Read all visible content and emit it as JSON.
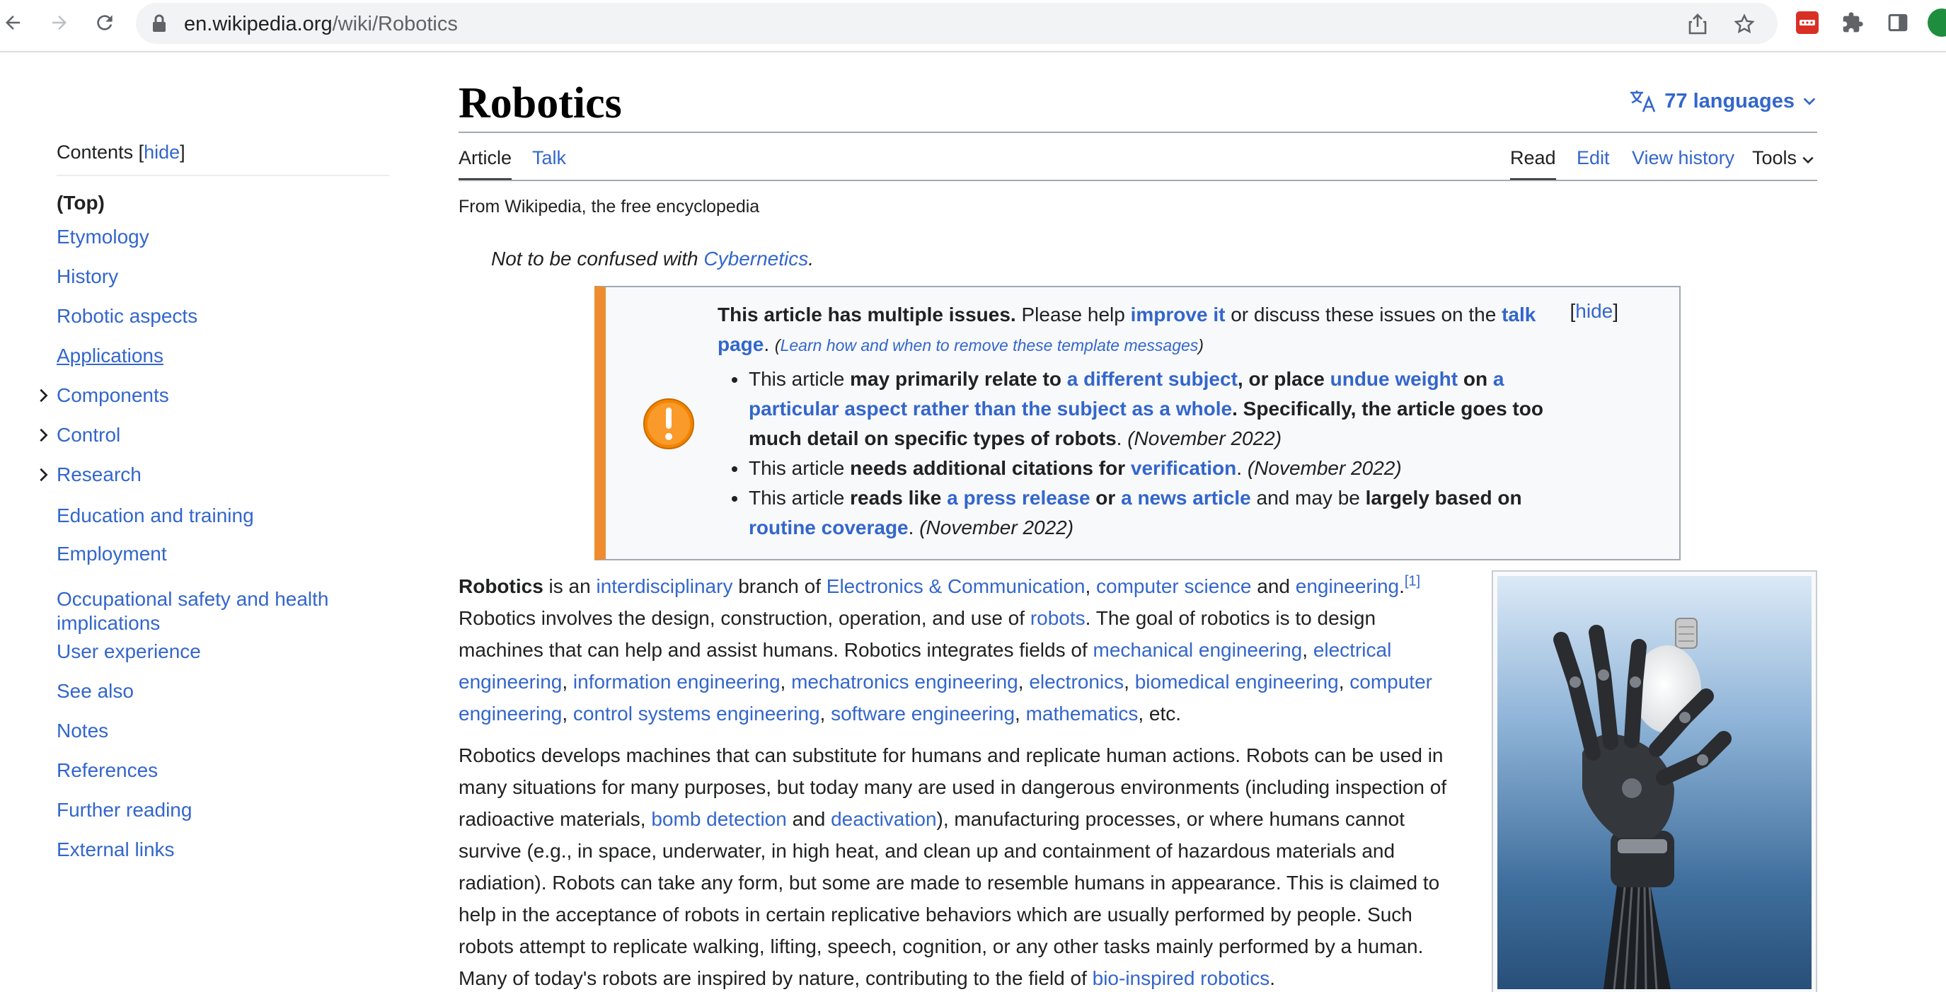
{
  "browser": {
    "url_host": "en.wikipedia.org",
    "url_path": "/wiki/Robotics"
  },
  "toc": {
    "label": "Contents",
    "hide_label": "hide",
    "items": [
      {
        "label": "(Top)"
      },
      {
        "label": "Etymology"
      },
      {
        "label": "History"
      },
      {
        "label": "Robotic aspects"
      },
      {
        "label": "Applications"
      },
      {
        "label": "Components"
      },
      {
        "label": "Control"
      },
      {
        "label": "Research"
      },
      {
        "label": "Education and training"
      },
      {
        "label": "Employment"
      },
      {
        "label": "Occupational safety and health implications"
      },
      {
        "label": "User experience"
      },
      {
        "label": "See also"
      },
      {
        "label": "Notes"
      },
      {
        "label": "References"
      },
      {
        "label": "Further reading"
      },
      {
        "label": "External links"
      }
    ]
  },
  "page": {
    "title": "Robotics",
    "languages_label": "77 languages",
    "tabs": {
      "article": "Article",
      "talk": "Talk",
      "read": "Read",
      "edit": "Edit",
      "history": "View history",
      "tools": "Tools"
    },
    "tagline": "From Wikipedia, the free encyclopedia",
    "hatnote_text": "Not to be confused with ",
    "hatnote_link": "Cybernetics",
    "hatnote_end": "."
  },
  "ambox": {
    "hide_label": "hide",
    "header_bold": "This article has multiple issues.",
    "header_text1": " Please help ",
    "header_link1": "improve it",
    "header_text2": " or discuss these issues on the ",
    "header_link2": "talk page",
    "header_text3": ". ",
    "learn_link": "Learn how and when to remove these template messages",
    "issue1": {
      "t1": "This article ",
      "b1": "may primarily relate to ",
      "l1": "a different subject",
      "b2": ", or place ",
      "l2": "undue weight",
      "b3": " on ",
      "l3": "a particular aspect rather than the subject as a whole",
      "b4": ". Specifically, the article goes too much detail on specific types of robots",
      "t2": ". ",
      "date": "(November 2022)"
    },
    "issue2": {
      "t1": "This article ",
      "b1": "needs additional citations for ",
      "l1": "verification",
      "t2": ". ",
      "date": "(November 2022)"
    },
    "issue3": {
      "t1": "This article ",
      "b1": "reads like ",
      "l1": "a press release",
      "b2": " or ",
      "l2": "a news article",
      "t2": " and may be ",
      "b3": "largely based on ",
      "l3": "routine coverage",
      "t3": ". ",
      "date": "(November 2022)"
    }
  },
  "body": {
    "p1": {
      "bold": "Robotics",
      "t1": " is an ",
      "l1": "interdisciplinary",
      "t2": " branch of ",
      "l2": "Electronics & Communication",
      "t3": ", ",
      "l3": "computer science",
      "t4": " and ",
      "l4": "engineering",
      "t5": ".",
      "ref": "[1]",
      "t6": " Robotics involves the design, construction, operation, and use of ",
      "l5": "robots",
      "t7": ". The goal of robotics is to design machines that can help and assist humans. Robotics integrates fields of ",
      "l6": "mechanical engineering",
      "t8": ", ",
      "l7": "electrical engineering",
      "t9": ", ",
      "l8": "information engineering",
      "t10": ", ",
      "l9": "mechatronics engineering",
      "t11": ", ",
      "l10": "electronics",
      "t12": ", ",
      "l11": "biomedical engineering",
      "t13": ", ",
      "l12": "computer engineering",
      "t14": ", ",
      "l13": "control systems engineering",
      "t15": ", ",
      "l14": "software engineering",
      "t16": ", ",
      "l15": "mathematics",
      "t17": ", etc."
    },
    "p2": {
      "t1": "Robotics develops machines that can substitute for humans and replicate human actions. Robots can be used in many situations for many purposes, but today many are used in dangerous environments (including inspection of radioactive materials, ",
      "l1": "bomb detection",
      "t2": " and ",
      "l2": "deactivation",
      "t3": "), manufacturing processes, or where humans cannot survive (e.g., in space, underwater, in high heat, and clean up and containment of hazardous materials and radiation). Robots can take any form, but some are made to resemble humans in appearance. This is claimed to help in the acceptance of robots in certain replicative behaviors which are usually performed by people. Such robots attempt to replicate walking, lifting, speech, cognition, or any other tasks mainly performed by a human. Many of today's robots are inspired by nature, contributing to the field of ",
      "l3": "bio-inspired robotics",
      "t4": "."
    }
  },
  "colors": {
    "link": "#3366cc",
    "ambox_accent": "#ee8c2f"
  }
}
